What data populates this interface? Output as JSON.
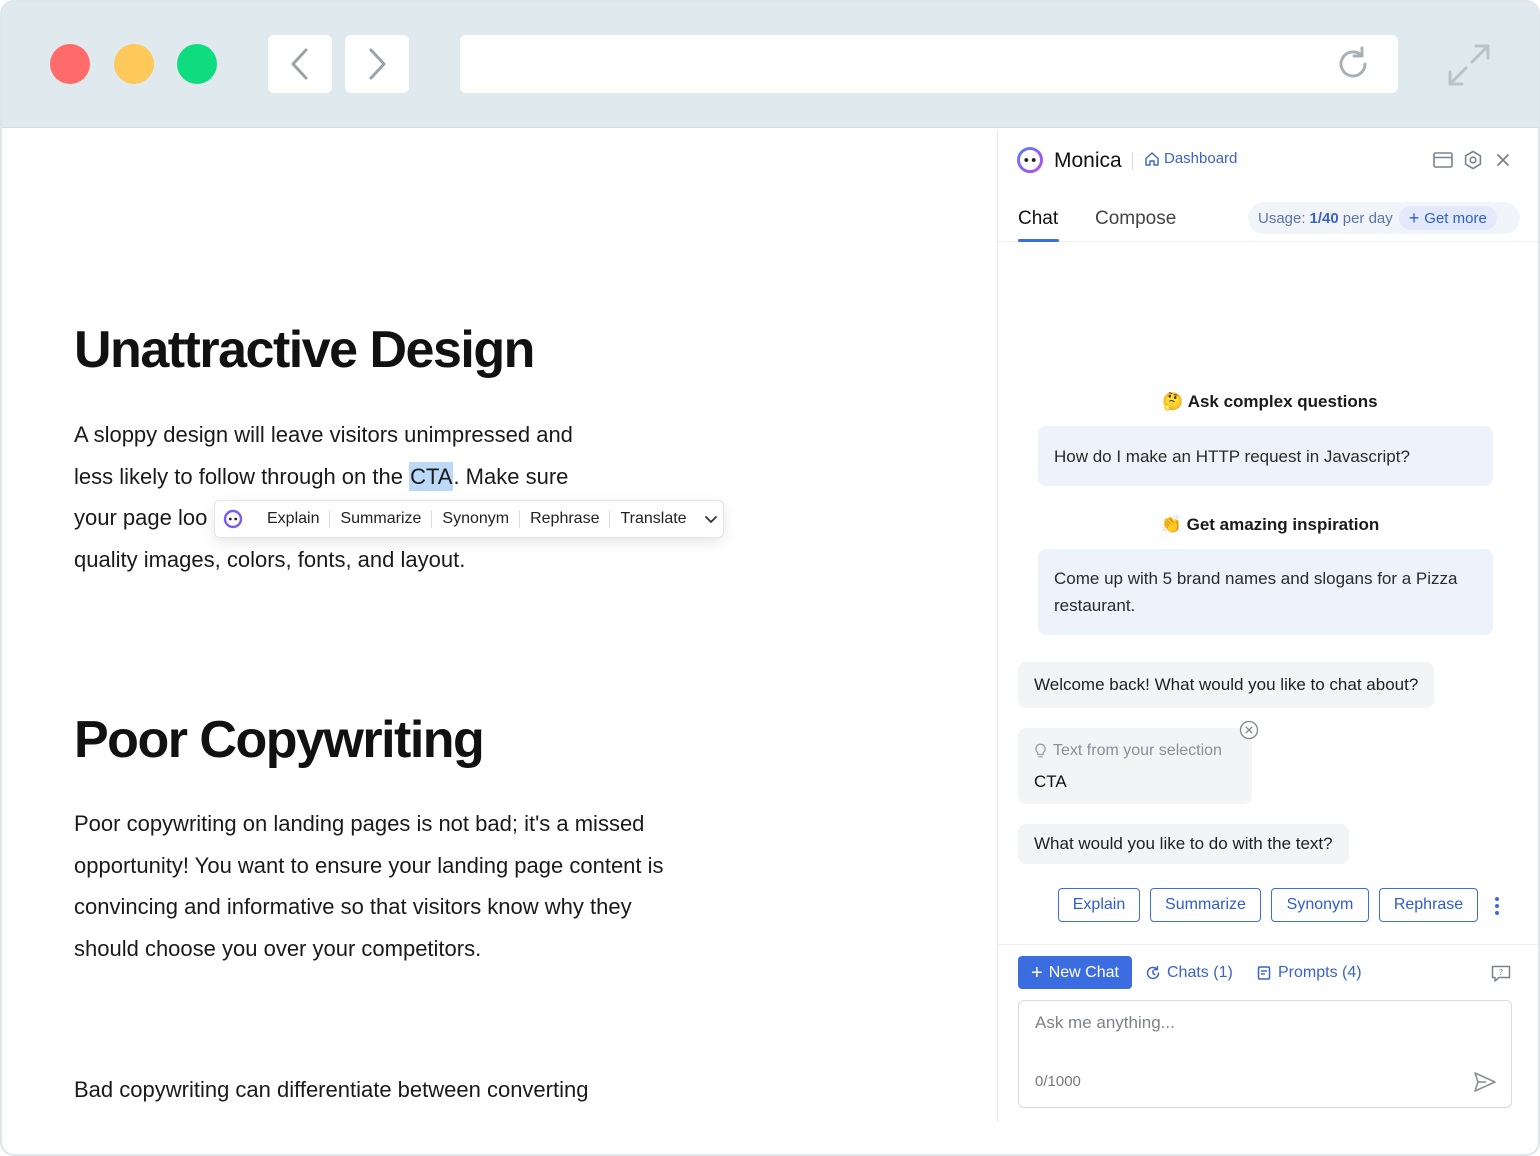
{
  "browser": {
    "url": "",
    "back_icon": "chevron-left-icon",
    "forward_icon": "chevron-right-icon",
    "reload_icon": "reload-icon",
    "expand_icon": "expand-icon"
  },
  "article": {
    "sections": [
      {
        "heading": "Unattractive Design",
        "para_before": "A sloppy design will leave visitors unimpressed and less likely to follow through on the ",
        "highlight": "CTA",
        "para_after": ". Make sure your page looks professional by using high-quality images, colors, fonts, and layout.",
        "line3_visible": "your page loo",
        "line4": "quality images, colors, fonts, and layout."
      },
      {
        "heading": "Poor Copywriting",
        "para": "Poor copywriting on landing pages is not bad; it's a missed opportunity! You want to ensure your landing page content is convincing and informative so that visitors know why they should choose you over your competitors.",
        "para2": "Bad copywriting can differentiate between converting"
      }
    ]
  },
  "selection_toolbar": {
    "actions": [
      "Explain",
      "Summarize",
      "Synonym",
      "Rephrase",
      "Translate"
    ]
  },
  "panel": {
    "title": "Monica",
    "dashboard_label": "Dashboard",
    "tabs": [
      {
        "label": "Chat",
        "active": true
      },
      {
        "label": "Compose",
        "active": false
      }
    ],
    "usage": {
      "prefix": "Usage:",
      "value": "1/40",
      "suffix": "per day",
      "get_more": "Get more"
    },
    "section1": {
      "emoji": "🤔",
      "title": "Ask complex questions",
      "example": "How do I make an HTTP request in Javascript?"
    },
    "section2": {
      "emoji": "👏",
      "title": "Get amazing inspiration",
      "example": "Come up with 5 brand names and slogans for a Pizza restaurant."
    },
    "welcome": "Welcome back! What would you like to chat about?",
    "selection": {
      "label": "Text from your selection",
      "value": "CTA"
    },
    "prompt_question": "What would you like to do with the text?",
    "quick_actions": [
      "Explain",
      "Summarize",
      "Synonym",
      "Rephrase"
    ],
    "footer": {
      "new_chat": "New Chat",
      "chats": "Chats (1)",
      "prompts": "Prompts (4)"
    },
    "input": {
      "placeholder": "Ask me anything...",
      "counter": "0/1000"
    }
  },
  "colors": {
    "accent": "#3c6de0",
    "highlight": "#bcd9f8",
    "chrome": "#dfe9ee",
    "dot_red": "#ff6b6b",
    "dot_yellow": "#ffc85a",
    "dot_green": "#0fdc7e"
  }
}
